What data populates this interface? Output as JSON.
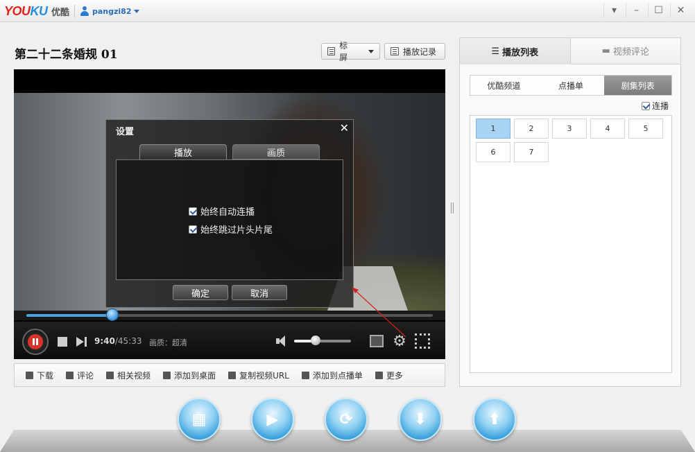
{
  "app": {
    "logo_latin": "YOUKU",
    "logo_cn": "优酷",
    "username": "pangzi82"
  },
  "window_buttons": [
    "▾",
    "–",
    "☐",
    "✕"
  ],
  "video": {
    "title": "第二十二条婚规 01",
    "screen_mode_label": "标屏",
    "history_label": "播放记录",
    "current_time": "9:40",
    "total_time": "45:33",
    "quality_label": "画质：超清",
    "progress_fraction": 0.212,
    "volume_fraction": 0.38
  },
  "settings_dialog": {
    "title": "设置",
    "close": "✕",
    "tabs": [
      "播放",
      "画质"
    ],
    "options": [
      {
        "label": "始终自动连播",
        "checked": true
      },
      {
        "label": "始终跳过片头片尾",
        "checked": true
      }
    ],
    "ok_label": "确定",
    "cancel_label": "取消"
  },
  "actions": [
    {
      "label": "下载",
      "icon": "download-icon"
    },
    {
      "label": "评论",
      "icon": "comment-icon"
    },
    {
      "label": "相关视频",
      "icon": "film-icon"
    },
    {
      "label": "添加到桌面",
      "icon": "desktop-icon"
    },
    {
      "label": "复制视频URL",
      "icon": "copy-icon"
    },
    {
      "label": "添加到点播单",
      "icon": "playlist-add-icon"
    },
    {
      "label": "更多",
      "icon": "more-icon"
    }
  ],
  "sidebar": {
    "tabs": [
      "播放列表",
      "视频评论"
    ],
    "subtabs": [
      "优酷频道",
      "点播单",
      "剧集列表"
    ],
    "active_subtab": 2,
    "autoplay_label": "连播",
    "episodes": [
      "1",
      "2",
      "3",
      "4",
      "5",
      "6",
      "7"
    ],
    "active_episode": 0
  },
  "colors": {
    "accent": "#2f9ad8",
    "progress": "#4aa3e0",
    "episode_active": "#a9d3f2",
    "logo_red": "#e2231a"
  }
}
